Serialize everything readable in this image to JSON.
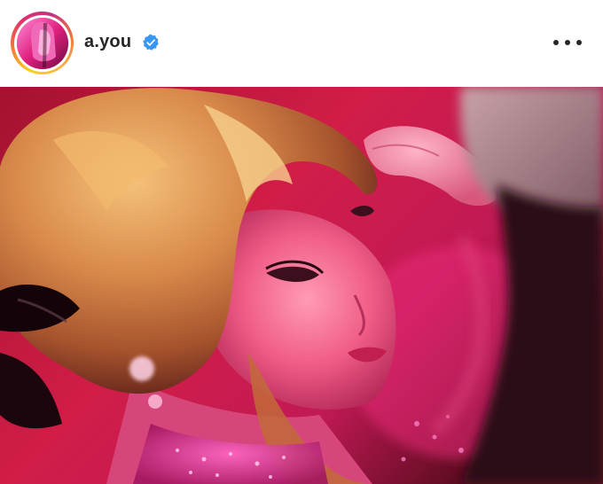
{
  "post": {
    "username": "a.you",
    "verified": true,
    "more_icon": "more-horizontal-icon",
    "avatar_icon": "profile-avatar",
    "media_type": "photo"
  },
  "colors": {
    "story_ring_start": "#f9d423",
    "story_ring_end": "#c13584",
    "verified_badge": "#3897f0",
    "text": "#262626"
  }
}
